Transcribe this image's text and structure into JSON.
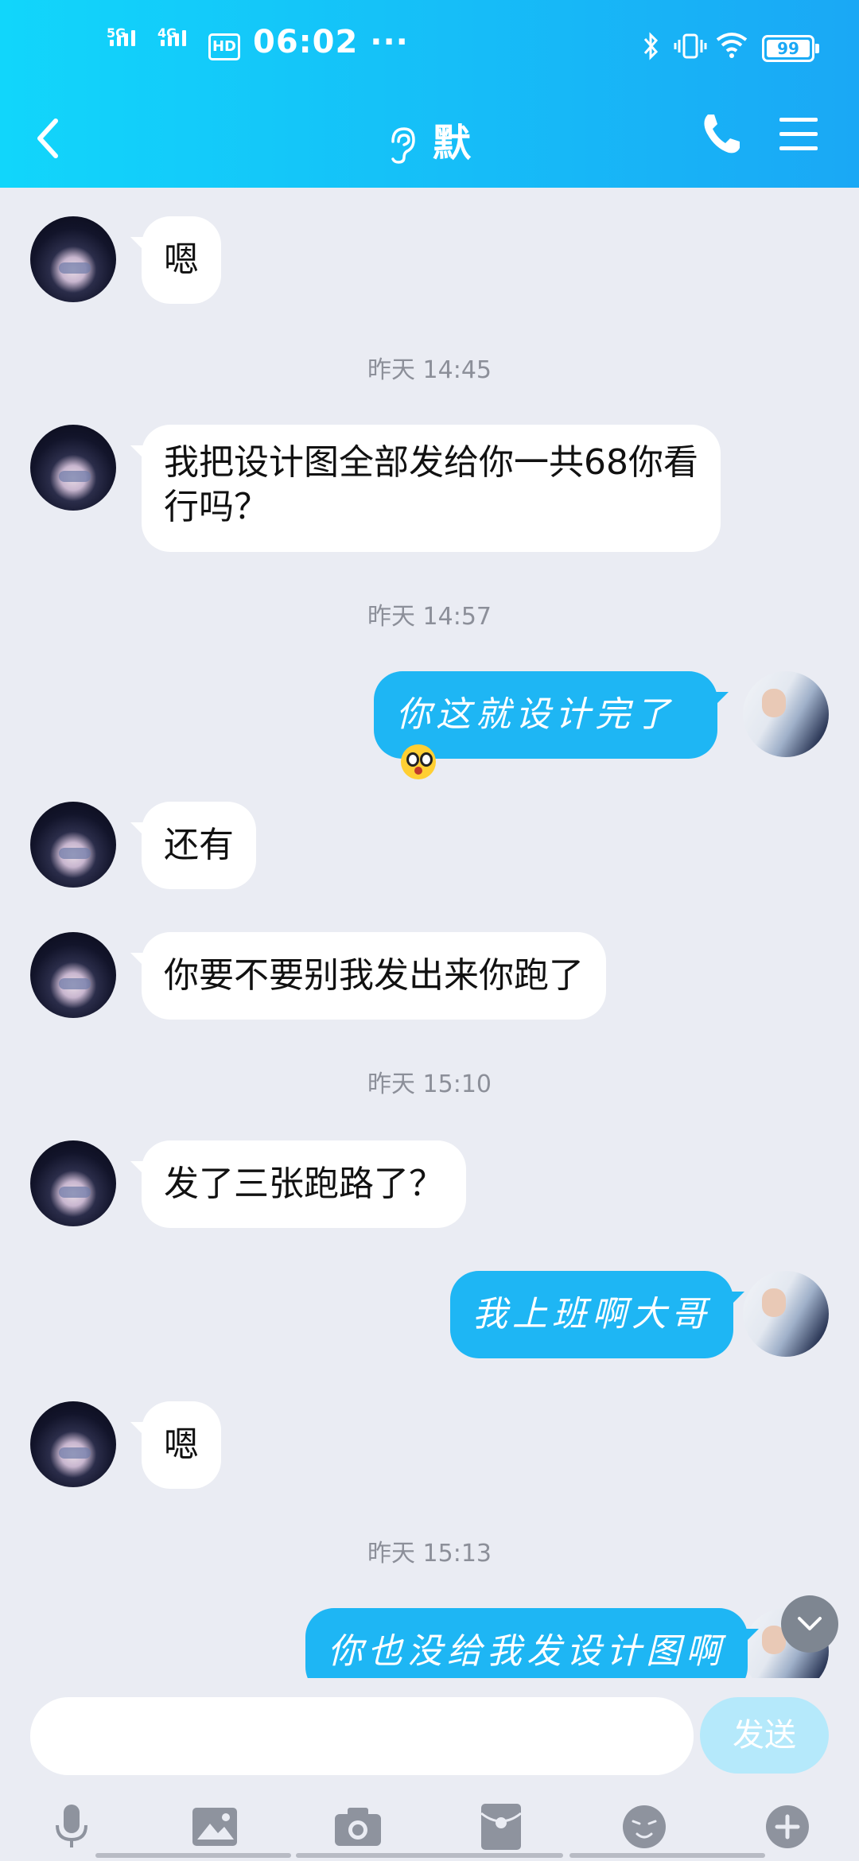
{
  "status_bar": {
    "time": "06:02",
    "dots": "···",
    "sim1": "5G",
    "sim2": "4G",
    "hd": "HD",
    "battery": "99"
  },
  "header": {
    "title": "默",
    "colors": {
      "start": "#11D6FB",
      "end": "#1AA8F5"
    }
  },
  "messages": [
    {
      "type": "in",
      "text": "嗯"
    },
    {
      "type": "time",
      "text": "昨天 14:45"
    },
    {
      "type": "in",
      "text": "我把设计图全部发给你一共68你看行吗？"
    },
    {
      "type": "time",
      "text": "昨天 14:57"
    },
    {
      "type": "out",
      "text": "你这就设计完了",
      "emoji": "flushed-face-icon"
    },
    {
      "type": "in",
      "text": "还有"
    },
    {
      "type": "in",
      "text": "你要不要别我发出来你跑了"
    },
    {
      "type": "time",
      "text": "昨天 15:10"
    },
    {
      "type": "in",
      "text": "发了三张跑路了？"
    },
    {
      "type": "out",
      "text": "我上班啊大哥"
    },
    {
      "type": "in",
      "text": "嗯"
    },
    {
      "type": "time",
      "text": "昨天 15:13"
    },
    {
      "type": "out",
      "text": "你也没给我发设计图啊"
    }
  ],
  "input": {
    "placeholder": "",
    "send_label": "发送"
  },
  "toolbar": [
    "microphone-icon",
    "image-icon",
    "camera-icon",
    "red-packet-icon",
    "emoji-icon",
    "plus-icon"
  ],
  "colors": {
    "bubble_out": "#1EB6F4",
    "bubble_in": "#FFFFFF",
    "background": "#EAECF3",
    "send_disabled": "#B5E9FB"
  }
}
